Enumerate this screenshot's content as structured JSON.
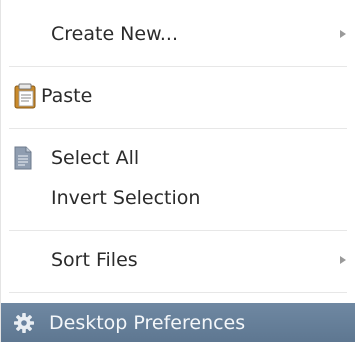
{
  "menu": {
    "create_new": {
      "label": "Create New...",
      "icon": "none",
      "submenu": true
    },
    "paste": {
      "label": "Paste",
      "icon": "clipboard-icon"
    },
    "select_all": {
      "label": "Select All",
      "icon": "document-icon"
    },
    "invert_selection": {
      "label": "Invert Selection"
    },
    "sort_files": {
      "label": "Sort Files",
      "submenu": true
    },
    "desktop_preferences": {
      "label": "Desktop Preferences",
      "icon": "gear-icon",
      "highlighted": true
    }
  },
  "colors": {
    "text": "#2b2b2b",
    "highlight_bg": "#6680a0",
    "highlight_text": "#f4f7fa",
    "separator": "#e7e7e7",
    "clipboard": "#c98a2b",
    "document": "#8896a8"
  }
}
